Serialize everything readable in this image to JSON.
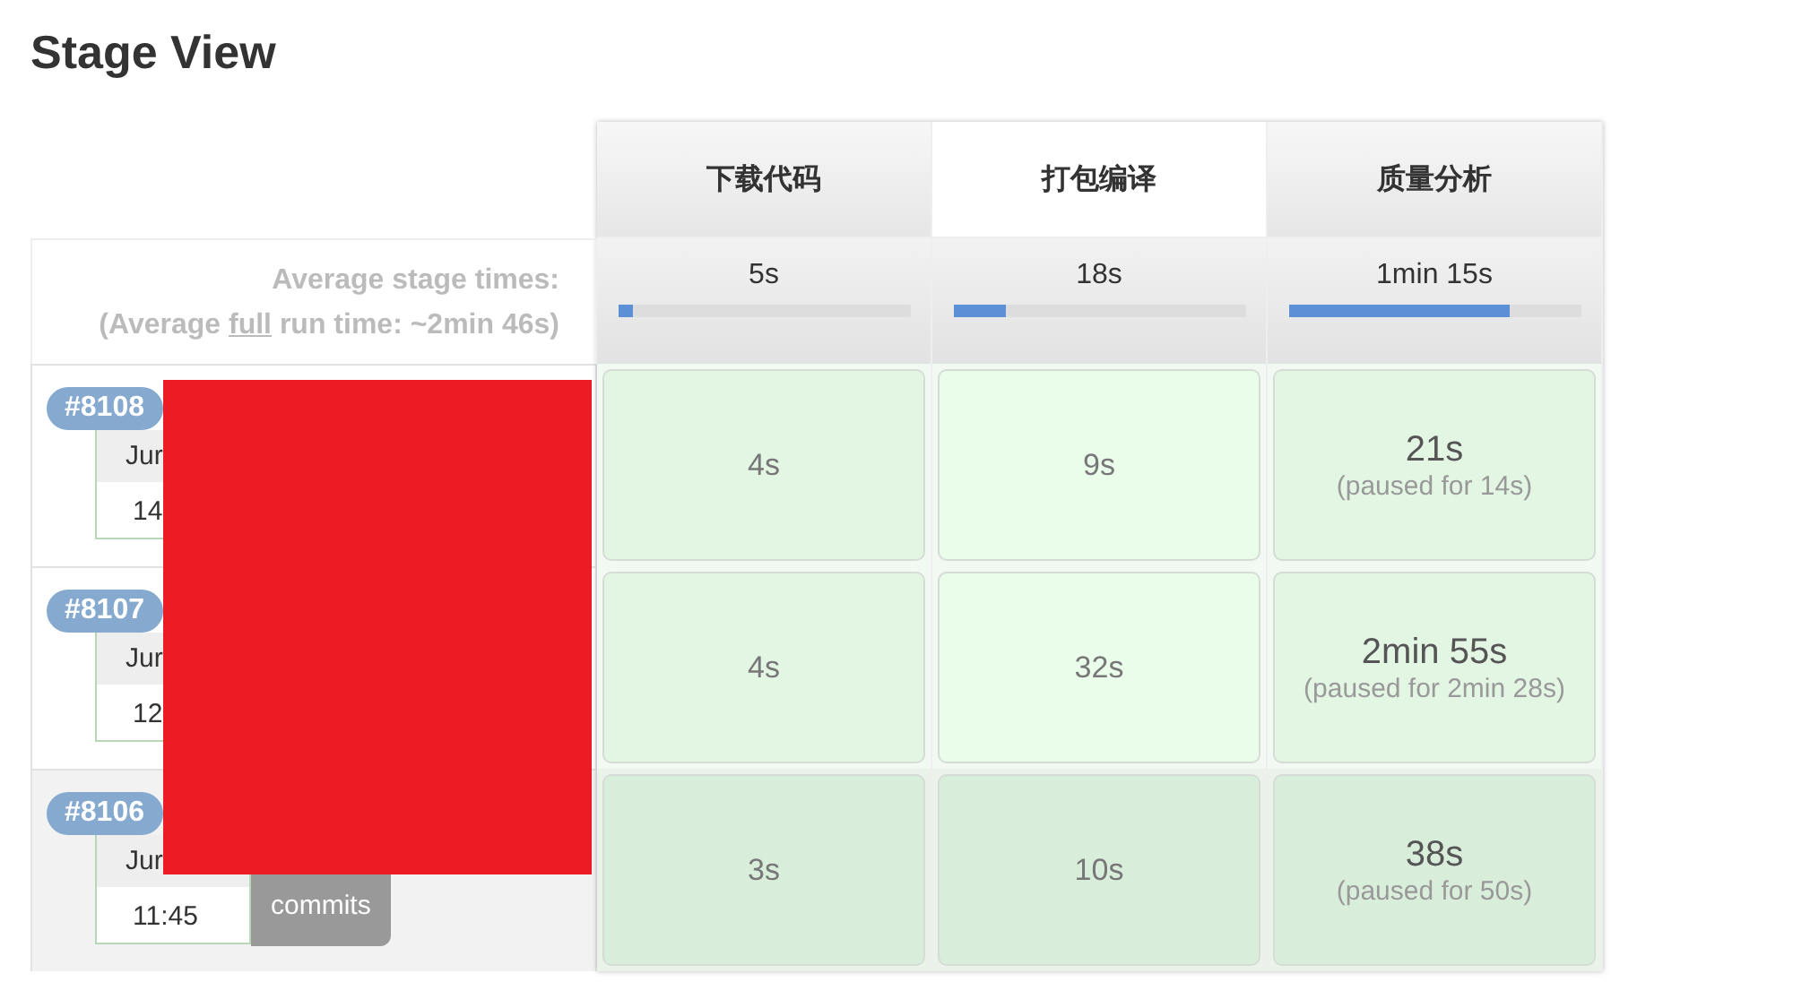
{
  "title": "Stage View",
  "average": {
    "label": "Average stage times:",
    "full_run_before": "(Average ",
    "full_run_link": "full",
    "full_run_after": " run time: ~2min 46s)"
  },
  "stages": [
    {
      "name": "下载代码",
      "highlighted": false,
      "average": "5s",
      "level": 0.05
    },
    {
      "name": "打包编译",
      "highlighted": true,
      "average": "18s",
      "level": 0.18
    },
    {
      "name": "质量分析",
      "highlighted": false,
      "average": "1min 15s",
      "level": 0.76
    }
  ],
  "runs": [
    {
      "number": "#8108",
      "date": "Jur",
      "time": "14",
      "highlighted": false,
      "cells": [
        {
          "duration": "4s"
        },
        {
          "duration": "9s"
        },
        {
          "duration": "21s",
          "paused": "(paused for 14s)"
        }
      ]
    },
    {
      "number": "#8107",
      "date": "Jur",
      "time": "12",
      "highlighted": false,
      "cells": [
        {
          "duration": "4s"
        },
        {
          "duration": "32s"
        },
        {
          "duration": "2min 55s",
          "paused": "(paused for 2min 28s)"
        }
      ]
    },
    {
      "number": "#8106",
      "date": "Jur",
      "time": "11:45",
      "commits": "commits",
      "highlighted": true,
      "cells": [
        {
          "duration": "3s"
        },
        {
          "duration": "10s"
        },
        {
          "duration": "38s",
          "paused": "(paused for 50s)"
        }
      ]
    }
  ]
}
